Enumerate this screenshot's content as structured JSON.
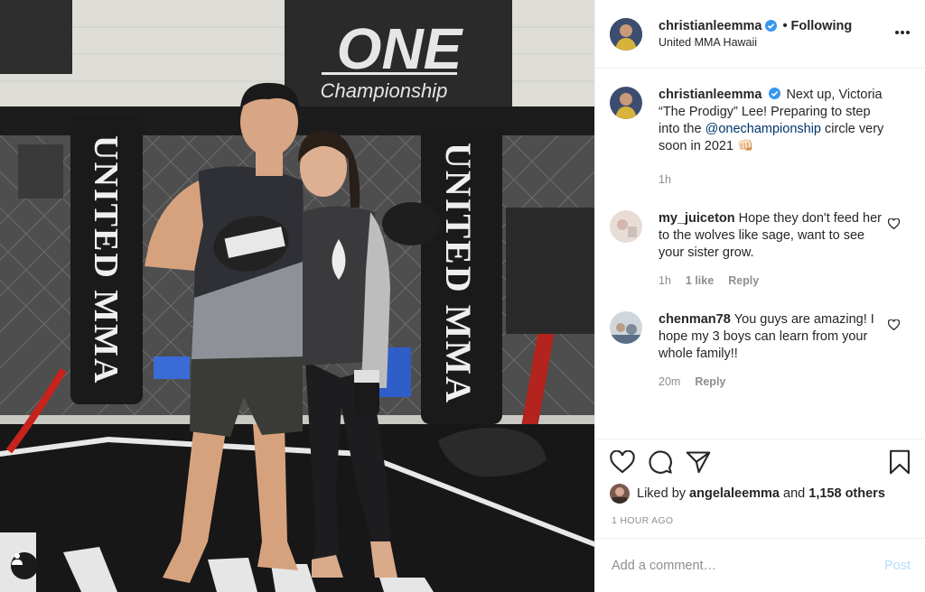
{
  "photo": {
    "banner_logo": "ONE",
    "banner_sub": "Championship",
    "pad_text_left": "UNITED MMA",
    "pad_text_right": "UNITED MMA"
  },
  "header": {
    "username": "christianleemma",
    "separator": "•",
    "follow_label": "Following",
    "location": "United MMA Hawaii"
  },
  "caption": {
    "username": "christianleemma",
    "text_1": "Next up, Victoria “The Prodigy” Lee! Preparing to step into the ",
    "mention": "@onechampionship",
    "text_2": " circle very soon in 2021 👊🏻",
    "time": "1h"
  },
  "comments": [
    {
      "username": "my_juiceton",
      "text": "Hope they don't feed her to the wolves like sage, want to see your sister grow.",
      "time": "1h",
      "likes": "1 like",
      "reply_label": "Reply"
    },
    {
      "username": "chenman78",
      "text": "You guys are amazing! I hope my 3 boys can learn from your whole family!!",
      "time": "20m",
      "reply_label": "Reply"
    }
  ],
  "likes": {
    "prefix": "Liked by",
    "user": "angelaleemma",
    "connector": "and",
    "others": "1,158 others"
  },
  "post_time": "1 HOUR AGO",
  "add_comment": {
    "placeholder": "Add a comment…",
    "post_label": "Post"
  },
  "colors": {
    "verified": "#3897f0",
    "link": "#00376b",
    "muted": "#8e8e8e",
    "post_disabled": "#b2dffc"
  }
}
